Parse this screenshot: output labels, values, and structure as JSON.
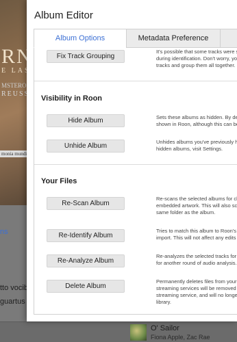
{
  "modal": {
    "title": "Album Editor",
    "tabs": [
      {
        "label": "Album Options",
        "active": true
      },
      {
        "label": "Metadata Preference",
        "active": false
      },
      {
        "label": "",
        "active": false
      }
    ],
    "sections": {
      "grouping": {
        "button": "Fix Track Grouping",
        "description": [
          "It's possible that some tracks were se",
          "during identification. Don't worry, yo",
          "tracks and group them all together."
        ]
      },
      "visibility": {
        "title": "Visibility in Roon",
        "hide_button": "Hide Album",
        "hide_description": [
          "Sets these albums as hidden. By defa",
          "shown in Roon, although this can be"
        ],
        "unhide_button": "Unhide Album",
        "unhide_description": [
          "Unhides albums you've previously hi",
          "hidden albums, visit Settings."
        ]
      },
      "files": {
        "title": "Your Files",
        "rescan_button": "Re-Scan Album",
        "rescan_description": [
          "Re-scans the selected albums for cha",
          "embedded artwork. This will also sca",
          "same folder as the album."
        ],
        "reidentify_button": "Re-Identify Album",
        "reidentify_description": [
          "Tries to match this album to Roon's c",
          "import. This will not affect any edits y"
        ],
        "reanalyze_button": "Re-Analyze Album",
        "reanalyze_description": [
          "Re-analyzes the selected tracks for c",
          "for another round of audio analysis."
        ],
        "delete_button": "Delete Album",
        "delete_description": [
          "Permanently deletes files from your",
          "streaming services will be removed f",
          "streaming service, and will no longer",
          "library."
        ]
      }
    }
  },
  "background": {
    "art_title": "RN",
    "art_sub1": "E LASS",
    "art_sub2": "MSTERO",
    "art_sub3": "REUSS",
    "art_label": "monia\nmundi",
    "list_tabs": "ns",
    "list_row1": "tto vocibu",
    "list_row2": "guartus",
    "now_playing": {
      "song": "O' Sailor",
      "artist": "Fiona Apple, Zac Rae"
    }
  },
  "colors": {
    "accent": "#3b6fd4"
  }
}
